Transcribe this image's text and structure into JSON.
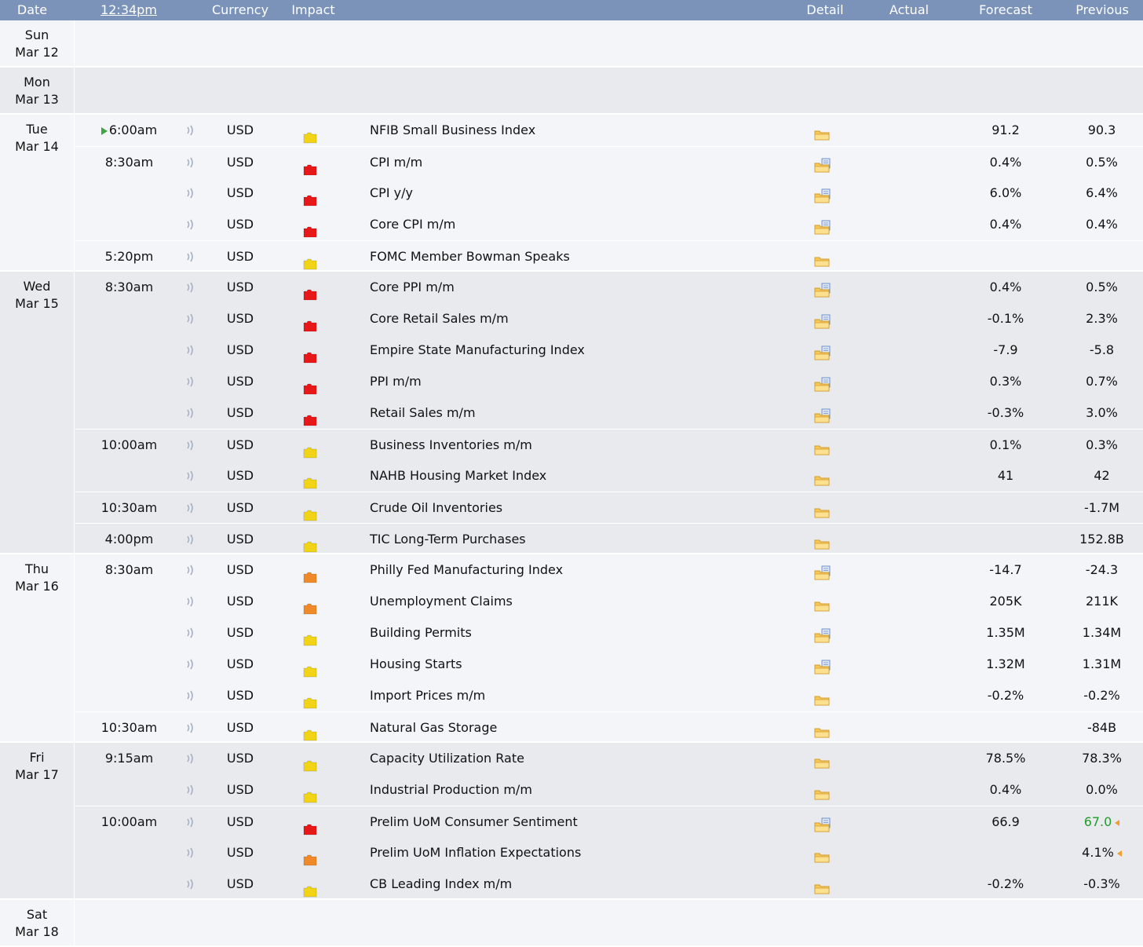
{
  "header": {
    "date": "Date",
    "time": "12:34pm",
    "currency": "Currency",
    "impact": "Impact",
    "detail": "Detail",
    "actual": "Actual",
    "forecast": "Forecast",
    "previous": "Previous"
  },
  "colors": {
    "header_bg": "#7b93b8",
    "high": "#e81818",
    "medium": "#f08a28",
    "low": "#f2d417",
    "better": "#1f9c2a",
    "revised_arrow": "#f0a030"
  },
  "days": [
    {
      "day": "Sun",
      "date": "Mar 12",
      "rows": []
    },
    {
      "day": "Mon",
      "date": "Mar 13",
      "rows": []
    },
    {
      "day": "Tue",
      "date": "Mar 14",
      "rows": [
        {
          "time": "6:00am",
          "current": true,
          "currency": "USD",
          "impact": "low",
          "title": "NFIB Small Business Index",
          "detail": "folder",
          "actual": "",
          "forecast": "91.2",
          "previous": "90.3"
        },
        {
          "time": "8:30am",
          "currency": "USD",
          "impact": "high",
          "title": "CPI m/m",
          "detail": "folder-doc",
          "actual": "",
          "forecast": "0.4%",
          "previous": "0.5%"
        },
        {
          "time": "",
          "currency": "USD",
          "impact": "high",
          "title": "CPI y/y",
          "detail": "folder-doc",
          "actual": "",
          "forecast": "6.0%",
          "previous": "6.4%"
        },
        {
          "time": "",
          "currency": "USD",
          "impact": "high",
          "title": "Core CPI m/m",
          "detail": "folder-doc",
          "actual": "",
          "forecast": "0.4%",
          "previous": "0.4%"
        },
        {
          "time": "5:20pm",
          "currency": "USD",
          "impact": "low",
          "title": "FOMC Member Bowman Speaks",
          "detail": "folder",
          "actual": "",
          "forecast": "",
          "previous": ""
        }
      ]
    },
    {
      "day": "Wed",
      "date": "Mar 15",
      "rows": [
        {
          "time": "8:30am",
          "currency": "USD",
          "impact": "high",
          "title": "Core PPI m/m",
          "detail": "folder-doc",
          "actual": "",
          "forecast": "0.4%",
          "previous": "0.5%"
        },
        {
          "time": "",
          "currency": "USD",
          "impact": "high",
          "title": "Core Retail Sales m/m",
          "detail": "folder-doc",
          "actual": "",
          "forecast": "-0.1%",
          "previous": "2.3%"
        },
        {
          "time": "",
          "currency": "USD",
          "impact": "high",
          "title": "Empire State Manufacturing Index",
          "detail": "folder-doc",
          "actual": "",
          "forecast": "-7.9",
          "previous": "-5.8"
        },
        {
          "time": "",
          "currency": "USD",
          "impact": "high",
          "title": "PPI m/m",
          "detail": "folder-doc",
          "actual": "",
          "forecast": "0.3%",
          "previous": "0.7%"
        },
        {
          "time": "",
          "currency": "USD",
          "impact": "high",
          "title": "Retail Sales m/m",
          "detail": "folder-doc",
          "actual": "",
          "forecast": "-0.3%",
          "previous": "3.0%"
        },
        {
          "time": "10:00am",
          "currency": "USD",
          "impact": "low",
          "title": "Business Inventories m/m",
          "detail": "folder",
          "actual": "",
          "forecast": "0.1%",
          "previous": "0.3%"
        },
        {
          "time": "",
          "currency": "USD",
          "impact": "low",
          "title": "NAHB Housing Market Index",
          "detail": "folder",
          "actual": "",
          "forecast": "41",
          "previous": "42"
        },
        {
          "time": "10:30am",
          "currency": "USD",
          "impact": "low",
          "title": "Crude Oil Inventories",
          "detail": "folder",
          "actual": "",
          "forecast": "",
          "previous": "-1.7M"
        },
        {
          "time": "4:00pm",
          "currency": "USD",
          "impact": "low",
          "title": "TIC Long-Term Purchases",
          "detail": "folder",
          "actual": "",
          "forecast": "",
          "previous": "152.8B"
        }
      ]
    },
    {
      "day": "Thu",
      "date": "Mar 16",
      "rows": [
        {
          "time": "8:30am",
          "currency": "USD",
          "impact": "medium",
          "title": "Philly Fed Manufacturing Index",
          "detail": "folder-doc",
          "actual": "",
          "forecast": "-14.7",
          "previous": "-24.3"
        },
        {
          "time": "",
          "currency": "USD",
          "impact": "medium",
          "title": "Unemployment Claims",
          "detail": "folder",
          "actual": "",
          "forecast": "205K",
          "previous": "211K"
        },
        {
          "time": "",
          "currency": "USD",
          "impact": "low",
          "title": "Building Permits",
          "detail": "folder-doc",
          "actual": "",
          "forecast": "1.35M",
          "previous": "1.34M"
        },
        {
          "time": "",
          "currency": "USD",
          "impact": "low",
          "title": "Housing Starts",
          "detail": "folder-doc",
          "actual": "",
          "forecast": "1.32M",
          "previous": "1.31M"
        },
        {
          "time": "",
          "currency": "USD",
          "impact": "low",
          "title": "Import Prices m/m",
          "detail": "folder",
          "actual": "",
          "forecast": "-0.2%",
          "previous": "-0.2%"
        },
        {
          "time": "10:30am",
          "currency": "USD",
          "impact": "low",
          "title": "Natural Gas Storage",
          "detail": "folder",
          "actual": "",
          "forecast": "",
          "previous": "-84B"
        }
      ]
    },
    {
      "day": "Fri",
      "date": "Mar 17",
      "rows": [
        {
          "time": "9:15am",
          "currency": "USD",
          "impact": "low",
          "title": "Capacity Utilization Rate",
          "detail": "folder",
          "actual": "",
          "forecast": "78.5%",
          "previous": "78.3%"
        },
        {
          "time": "",
          "currency": "USD",
          "impact": "low",
          "title": "Industrial Production m/m",
          "detail": "folder",
          "actual": "",
          "forecast": "0.4%",
          "previous": "0.0%"
        },
        {
          "time": "10:00am",
          "currency": "USD",
          "impact": "high",
          "title": "Prelim UoM Consumer Sentiment",
          "detail": "folder-doc",
          "actual": "",
          "forecast": "66.9",
          "previous": "67.0",
          "prev_better": true,
          "revised": true
        },
        {
          "time": "",
          "currency": "USD",
          "impact": "medium",
          "title": "Prelim UoM Inflation Expectations",
          "detail": "folder",
          "actual": "",
          "forecast": "",
          "previous": "4.1%",
          "revised": true
        },
        {
          "time": "",
          "currency": "USD",
          "impact": "low",
          "title": "CB Leading Index m/m",
          "detail": "folder",
          "actual": "",
          "forecast": "-0.2%",
          "previous": "-0.3%"
        }
      ]
    },
    {
      "day": "Sat",
      "date": "Mar 18",
      "rows": []
    }
  ]
}
